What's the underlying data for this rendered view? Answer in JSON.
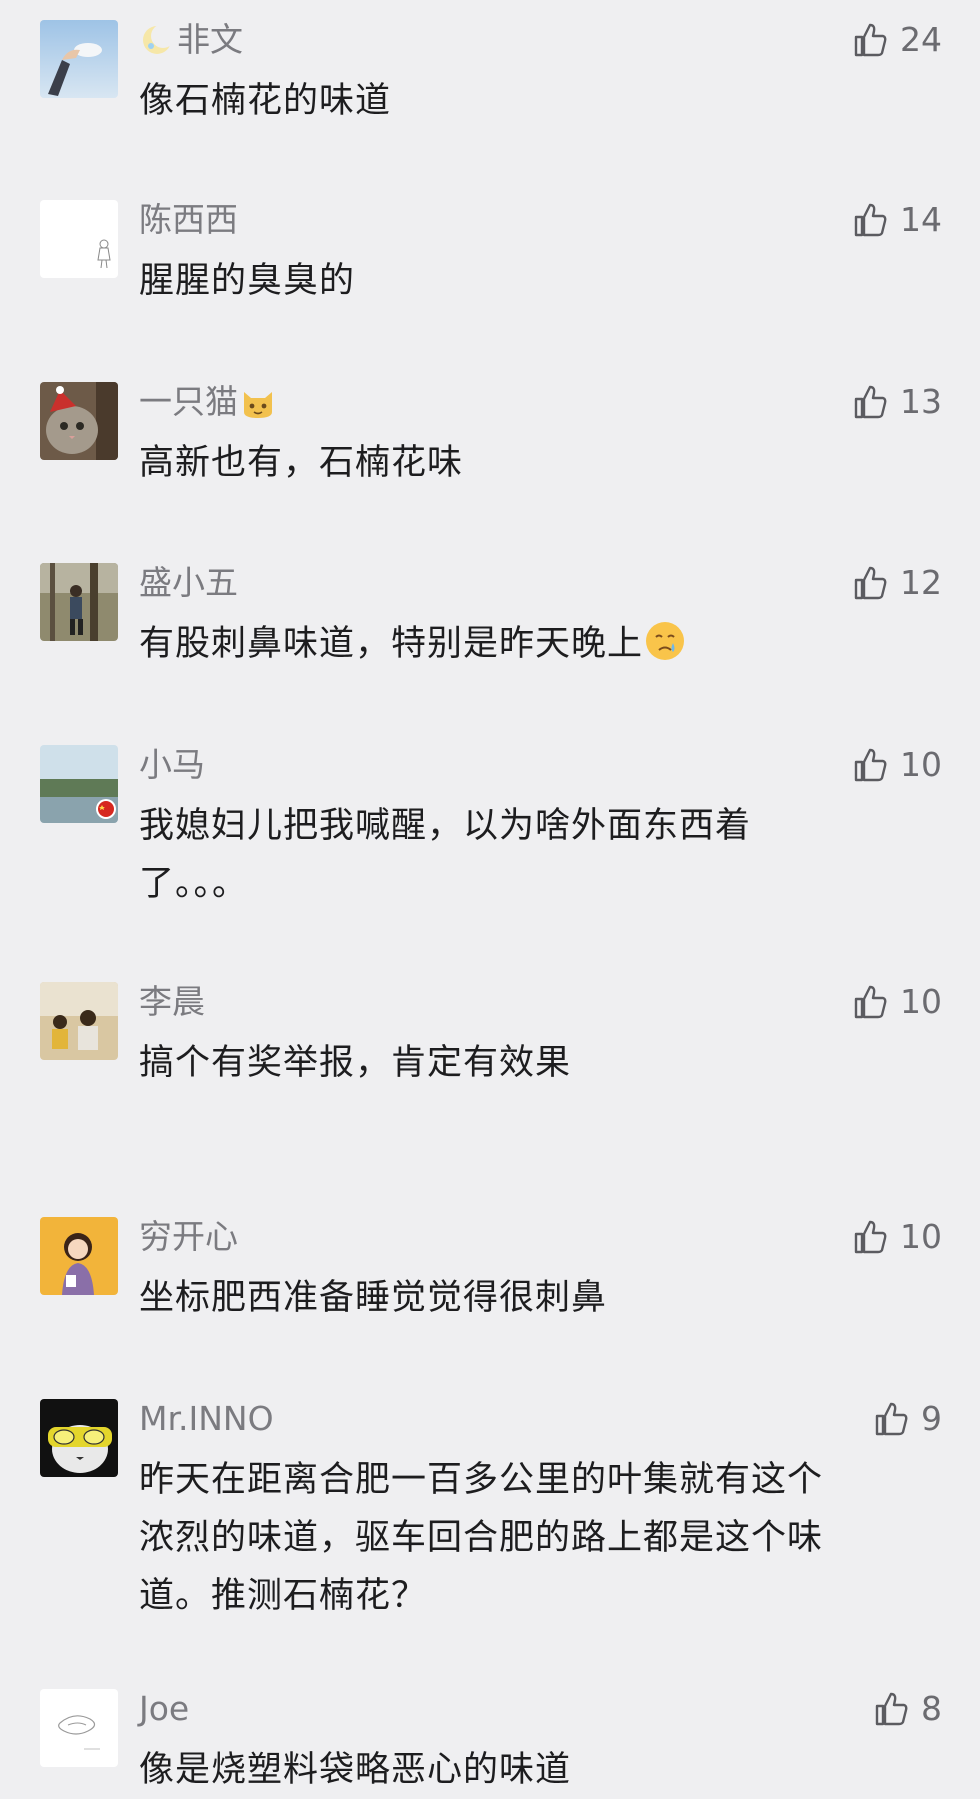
{
  "comments": [
    {
      "name": "非文",
      "text": "像石楠花的味道",
      "likes": "24",
      "avatar_icon": "hand-sky-avatar-icon",
      "name_emoji": "crescent-moon-icon"
    },
    {
      "name": "陈西西",
      "text": "腥腥的臭臭的",
      "likes": "14",
      "avatar_icon": "sketch-girl-avatar-icon"
    },
    {
      "name": "一只猫",
      "text": "高新也有，石楠花味",
      "likes": "13",
      "avatar_icon": "cat-santa-hat-avatar-icon",
      "name_emoji": "cat-face-icon"
    },
    {
      "name": "盛小五",
      "text": "有股刺鼻味道，特别是昨天晚上",
      "likes": "12",
      "avatar_icon": "forest-runner-avatar-icon",
      "text_emoji": "sad-face-emoji-icon"
    },
    {
      "name": "小马",
      "text": "我媳妇儿把我喊醒，以为啥外面东西着\n了。。。",
      "likes": "10",
      "avatar_icon": "lake-flag-avatar-icon"
    },
    {
      "name": "李晨",
      "text": "搞个有奖举报，肯定有效果",
      "likes": "10",
      "avatar_icon": "two-kids-avatar-icon"
    },
    {
      "name": "穷开心",
      "text": "坐标肥西准备睡觉觉得很刺鼻",
      "likes": "10",
      "avatar_icon": "girl-yellow-avatar-icon"
    },
    {
      "name": "Mr.INNO",
      "text": "昨天在距离合肥一百多公里的叶集就有这个\n浓烈的味道，驱车回合肥的路上都是这个味\n道。推测石楠花？",
      "likes": "9",
      "avatar_icon": "cat-sunglasses-avatar-icon"
    },
    {
      "name": "Joe",
      "text": "像是烧塑料袋略恶心的味道",
      "likes": "8",
      "avatar_icon": "sketch-logo-avatar-icon"
    }
  ],
  "colors": {
    "background": "#efeff1",
    "name": "#7b7b80",
    "text": "#1d1d1f",
    "like": "#6b6b70"
  }
}
